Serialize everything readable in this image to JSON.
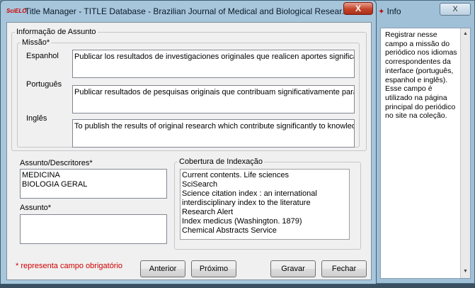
{
  "info_window": {
    "title": "Info",
    "close_label": "X",
    "text": "Registrar nesse campo a missão do periódico nos idiomas correspondentes da interface (português, espanhol e inglês). Esse campo é utilizado na página principal do periódico no site na coleção."
  },
  "main_window": {
    "logo": "SciELO",
    "title": "Title Manager - TITLE Database - Brazilian Journal of Medical and Biological Resear...",
    "close_label": "X"
  },
  "form": {
    "subject_group": "Informação de Assunto",
    "mission_group": "Missão*",
    "spanish_label": "Espanhol",
    "spanish_value": "Publicar los resultados de investigaciones originales que realicen aportes significativ",
    "portuguese_label": "Português",
    "portuguese_value": "Publicar resultados de pesquisas originais que contribuam significativamente para o",
    "english_label": "Inglês",
    "english_value": "To publish the results of original research which contribute significantly to knowledge",
    "descriptors_label": "Assunto/Descritores*",
    "descriptors": [
      "MEDICINA",
      "BIOLOGIA GERAL"
    ],
    "subject_label": "Assunto*",
    "subject_value": "",
    "coverage_group": "Cobertura de Indexação",
    "coverage": [
      "Current contents. Life sciences",
      "SciSearch",
      "Science citation index : an international interdisciplinary index to the literature",
      "Research Alert",
      "Index medicus (Washington. 1879)",
      "Chemical Abstracts Service"
    ],
    "required_note": "* representa campo obrigatório"
  },
  "buttons": {
    "previous": "Anterior",
    "next": "Próximo",
    "save": "Gravar",
    "close": "Fechar"
  }
}
